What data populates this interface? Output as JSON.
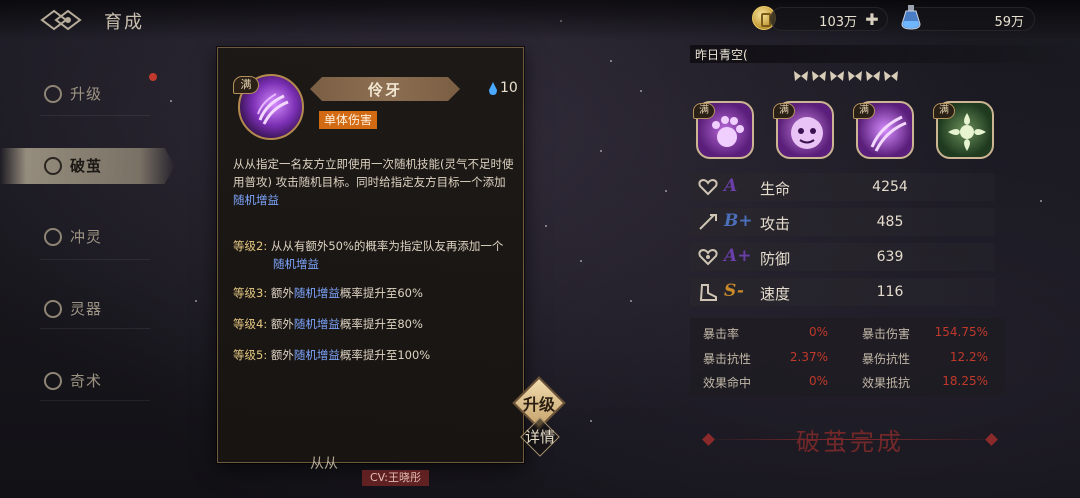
{
  "header": {
    "title": "育成"
  },
  "resources": {
    "gold": "103万",
    "potion": "59万"
  },
  "nav": {
    "items": [
      {
        "label": "升级"
      },
      {
        "label": "破茧"
      },
      {
        "label": "冲灵"
      },
      {
        "label": "灵器"
      },
      {
        "label": "奇术"
      }
    ]
  },
  "skill_popup": {
    "max_badge": "满",
    "name": "伶牙",
    "cost": "10",
    "tag": "单体伤害",
    "description_parts": [
      "从从指定一名友方立即使用一次随机技能(灵气不足时使用普攻) 攻击随机目标。同时给指定友方目标一个添加",
      "随机增益"
    ],
    "levels": [
      {
        "label": "等级2:",
        "text_a": "从从有额外50%的概率为指定队友再添加一个",
        "highlight": "随机增益",
        "text_b": ""
      },
      {
        "label": "等级3:",
        "text_a": "额外",
        "highlight": "随机增益",
        "text_b": "概率提升至60%"
      },
      {
        "label": "等级4:",
        "text_a": "额外",
        "highlight": "随机增益",
        "text_b": "概率提升至80%"
      },
      {
        "label": "等级5:",
        "text_a": "额外",
        "highlight": "随机增益",
        "text_b": "概率提升至100%"
      }
    ]
  },
  "character": {
    "name": "昨日青空(",
    "star_count": 6,
    "skill_badges": [
      "满",
      "满",
      "满",
      "满"
    ],
    "stats": [
      {
        "grade": "A",
        "label": "生命",
        "value": "4254",
        "grade_color": "#6b3fa8"
      },
      {
        "grade": "B+",
        "label": "攻击",
        "value": "485",
        "grade_color": "#4b6fb8"
      },
      {
        "grade": "A+",
        "label": "防御",
        "value": "639",
        "grade_color": "#6b3fa8"
      },
      {
        "grade": "S-",
        "label": "速度",
        "value": "116",
        "grade_color": "#c98a2a"
      }
    ],
    "sub_stats": [
      {
        "label": "暴击率",
        "value": "0%"
      },
      {
        "label": "暴击伤害",
        "value": "154.75%"
      },
      {
        "label": "暴击抗性",
        "value": "2.37%"
      },
      {
        "label": "暴伤抗性",
        "value": "12.2%"
      },
      {
        "label": "效果命中",
        "value": "0%"
      },
      {
        "label": "效果抵抗",
        "value": "18.25%"
      }
    ]
  },
  "buttons": {
    "upgrade": "升级",
    "details": "详情"
  },
  "complete_label": "破茧完成",
  "footer": {
    "char_name": "从从",
    "cv": "CV:王晓彤"
  },
  "colors": {
    "accent": "#b48a4e",
    "tag": "#d16a13",
    "highlight": "#7ea6ff",
    "level_label": "#e4c780",
    "sub_value": "#c0392b"
  }
}
